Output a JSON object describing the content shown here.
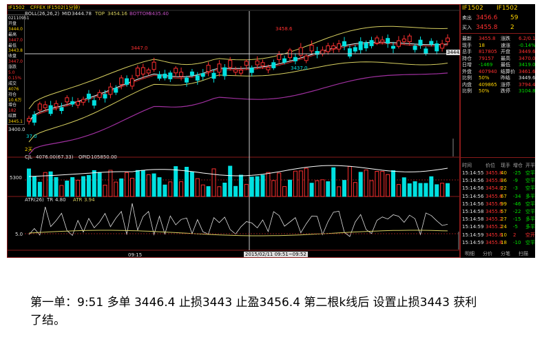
{
  "titlebar": {
    "label1": "IF1502",
    "label2": "CFFEX IF1502(1分钟)"
  },
  "boll": {
    "name": "BOLL(26,26,2)",
    "mid_label": "MID",
    "mid": "3444.78",
    "top_label": "TOP",
    "top": "3454.16",
    "bottom_label": "BOTTOM",
    "bottom": "3435.40"
  },
  "left_info": [
    {
      "text": "02110951",
      "color": "#e0e0e0"
    },
    {
      "text": "开盘",
      "color": "#e0e0e0"
    },
    {
      "text": "3444.0",
      "color": "#ffd400"
    },
    {
      "text": "最高",
      "color": "#e0e0e0"
    },
    {
      "text": "3447.0",
      "color": "#ff3030"
    },
    {
      "text": "最低",
      "color": "#e0e0e0"
    },
    {
      "text": "3443.8",
      "color": "#ffd400"
    },
    {
      "text": "收盘",
      "color": "#e0e0e0"
    },
    {
      "text": "3447.0",
      "color": "#ff3030"
    },
    {
      "text": "涨跌",
      "color": "#e0e0e0"
    },
    {
      "text": "5.0",
      "color": "#ff3030"
    },
    {
      "text": "0.15%",
      "color": "#ff3030"
    },
    {
      "text": "成交",
      "color": "#e0e0e0"
    },
    {
      "text": "4076",
      "color": "#ffd400"
    },
    {
      "text": "持仓",
      "color": "#e0e0e0"
    },
    {
      "text": "10.6万",
      "color": "#ffd400"
    },
    {
      "text": "增仓",
      "color": "#e0e0e0"
    },
    {
      "text": "182",
      "color": "#ff3030"
    },
    {
      "text": "结算",
      "color": "#e0e0e0"
    },
    {
      "text": "3445.1",
      "color": "#ffd400"
    }
  ],
  "price_labels": {
    "high1": "3447.0",
    "high2": "3458.6",
    "low1": "3437.0",
    "axis_low": "3400.0",
    "cursor_price": "3444.1",
    "left_low": "37.0"
  },
  "count_label": "2天",
  "vol": {
    "cjl_label": "CJL",
    "cjl": "4076.00(67.33)",
    "opid_label": "OPID",
    "opid": "105850.00",
    "axis": "5300"
  },
  "atr": {
    "name": "ATR(26)",
    "tr_label": "TR",
    "tr": "4.80",
    "atr_label": "ATR",
    "atr": "3.94",
    "axis": "5.0"
  },
  "time_axis": {
    "start": "09:15",
    "range": "2015/02/11 09:51~09:52"
  },
  "quote": {
    "title1": "IF1502",
    "title2": "IF1502",
    "ask_label": "卖出",
    "ask_price": "3456.6",
    "ask_vol": "59",
    "bid_label": "买入",
    "bid_price": "3455.8",
    "bid_vol": "2",
    "rows": [
      [
        "最新",
        "3455.8",
        "涨跌",
        "6.2/0.18%"
      ],
      [
        "现手",
        "18",
        "速涨",
        "-0.14%"
      ],
      [
        "总手",
        "817805",
        "开盘",
        "3449.6"
      ],
      [
        "持仓",
        "79157",
        "最高",
        "3470.0"
      ],
      [
        "日增",
        "-1469",
        "最低",
        "3419.0"
      ],
      [
        "外盘",
        "407940",
        "结算价",
        "3461.6"
      ],
      [
        "比例",
        "50%",
        "昨结",
        "3449.6"
      ],
      [
        "内盘",
        "409865",
        "涨停",
        "3794.4"
      ],
      [
        "比例",
        "50%",
        "跌停",
        "3104.8"
      ]
    ],
    "tick_headers": [
      "时间",
      "价位",
      "现手",
      "增仓",
      "开平"
    ],
    "ticks": [
      [
        "15:14:55",
        "3455.8",
        "40",
        "-25",
        "空平"
      ],
      [
        "15:14:56",
        "3455.8",
        "36",
        "-9",
        "空平"
      ],
      [
        "15:14:56",
        "3454.8",
        "22",
        "-3",
        "空平"
      ],
      [
        "15:14:56",
        "3455.6",
        "67",
        "-34",
        "多平"
      ],
      [
        "15:14:56",
        "3455.6",
        "99",
        "-46",
        "空平"
      ],
      [
        "15:14:58",
        "3455.8",
        "57",
        "-22",
        "空平"
      ],
      [
        "15:14:58",
        "3455.2",
        "27",
        "-15",
        "多平"
      ],
      [
        "15:14:59",
        "3455.2",
        "24",
        "-5",
        "多平"
      ],
      [
        "15:14:59",
        "3455.8",
        "10",
        "2",
        "空开"
      ],
      [
        "15:14:59",
        "3455.8",
        "18",
        "-10",
        "空平"
      ]
    ],
    "bottom_tabs": [
      "明细",
      "分价",
      "分笔",
      "扫描"
    ]
  },
  "caption": {
    "line1": "第一单：9:51 多单 3446.4 止损3443 止盈3456.4  第二根k线后 设置止损3443 获利",
    "line2": "了结。"
  }
}
